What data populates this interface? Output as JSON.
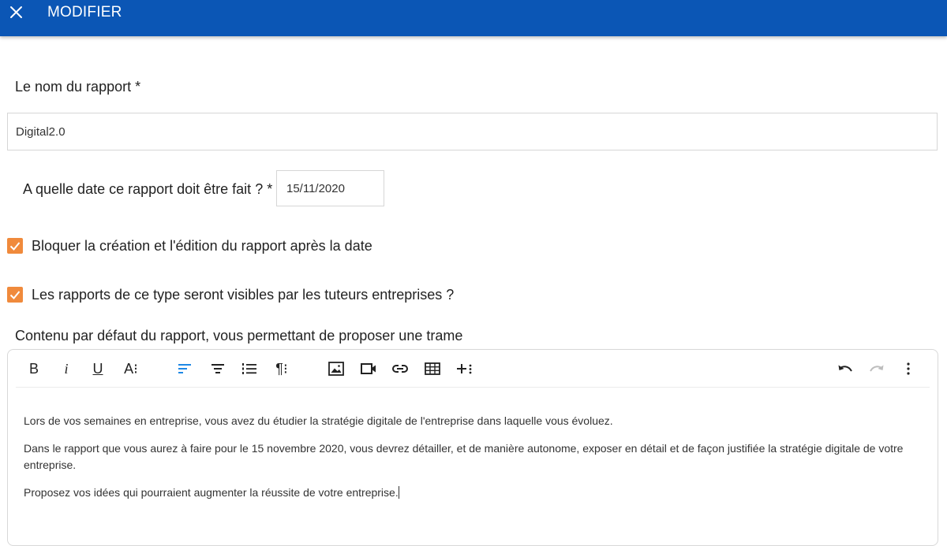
{
  "header": {
    "title": "MODIFIER",
    "close_icon": "close-icon",
    "background_color": "#0b56b5"
  },
  "form": {
    "name_label": "Le nom du rapport *",
    "name_value": "Digital2.0",
    "date_label": "A quelle date ce rapport doit être fait ? *",
    "date_value": "15/11/2020",
    "checkbox_block": {
      "label": "Bloquer la création et l'édition du rapport après la date",
      "checked": true
    },
    "checkbox_visible": {
      "label": "Les rapports de ce type seront visibles par les tuteurs entreprises ?",
      "checked": true
    },
    "checkbox_color": "#f08a3c",
    "content_label": "Contenu par défaut du rapport, vous permettant de proposer une trame"
  },
  "editor": {
    "toolbar": [
      {
        "name": "bold-button",
        "icon": "bold-icon",
        "label": "B"
      },
      {
        "name": "italic-button",
        "icon": "italic-icon",
        "label": "i"
      },
      {
        "name": "underline-button",
        "icon": "underline-icon",
        "label": "U"
      },
      {
        "name": "font-style-button",
        "icon": "font-style-icon",
        "label": "A⁝"
      },
      {
        "name": "align-left-button",
        "icon": "align-left-icon",
        "active": true
      },
      {
        "name": "align-center-button",
        "icon": "align-center-icon"
      },
      {
        "name": "ordered-list-button",
        "icon": "ordered-list-icon"
      },
      {
        "name": "paragraph-button",
        "icon": "paragraph-icon",
        "label": "¶⁝"
      },
      {
        "name": "insert-image-button",
        "icon": "image-icon"
      },
      {
        "name": "insert-video-button",
        "icon": "video-icon"
      },
      {
        "name": "insert-link-button",
        "icon": "link-icon"
      },
      {
        "name": "insert-table-button",
        "icon": "table-icon"
      },
      {
        "name": "insert-more-button",
        "icon": "plus-more-icon"
      },
      {
        "name": "undo-button",
        "icon": "undo-icon"
      },
      {
        "name": "redo-button",
        "icon": "redo-icon",
        "disabled": true
      },
      {
        "name": "more-options-button",
        "icon": "more-vertical-icon"
      }
    ],
    "active_color": "#1e88e5",
    "paragraphs": [
      "Lors de vos semaines en entreprise, vous avez du étudier la stratégie digitale de l'entreprise dans laquelle vous évoluez.",
      "Dans le rapport que vous aurez à faire pour le 15 novembre 2020, vous devrez détailler, et de manière autonome, exposer en détail et de façon justifiée la stratégie digitale de votre entreprise.",
      "Proposez vos idées qui pourraient augmenter la réussite de votre entreprise."
    ]
  }
}
